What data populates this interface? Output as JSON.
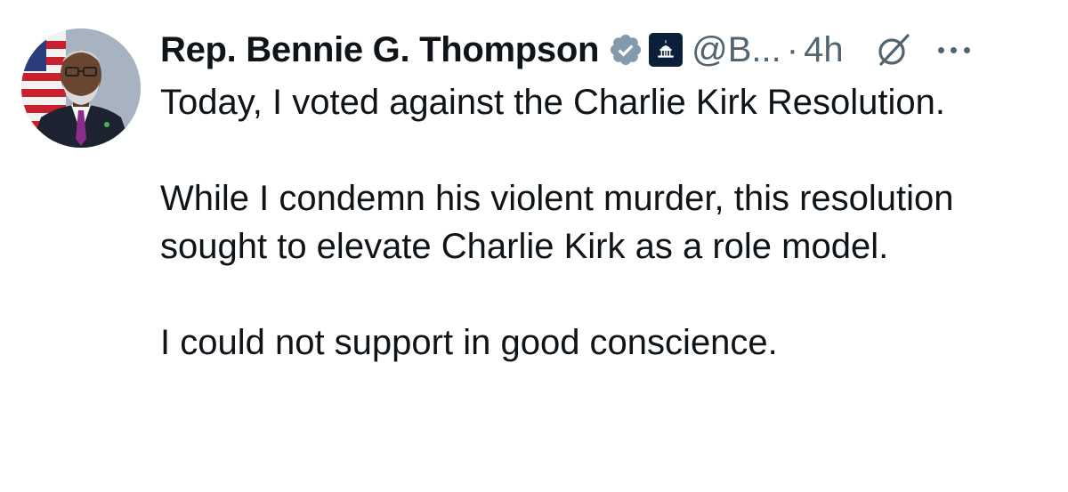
{
  "author": {
    "display_name": "Rep. Bennie G. Thompson",
    "handle": "@B...",
    "separator": "·",
    "time": "4h",
    "verified_icon": "verified-badge-icon",
    "affiliate_icon": "capitol-affiliate-icon",
    "colors": {
      "name": "#0f1419",
      "meta": "#536471",
      "badge": "#829aab",
      "affiliate_bg": "#0b1f3a"
    }
  },
  "actions": {
    "grok_icon": "grok-icon",
    "more_icon": "more-icon"
  },
  "tweet": {
    "paragraphs": [
      "Today, I voted against the Charlie Kirk Resolution.",
      "While I condemn his violent murder, this resolution sought to elevate Charlie Kirk as a role model.",
      "I could not support in good conscience."
    ]
  }
}
